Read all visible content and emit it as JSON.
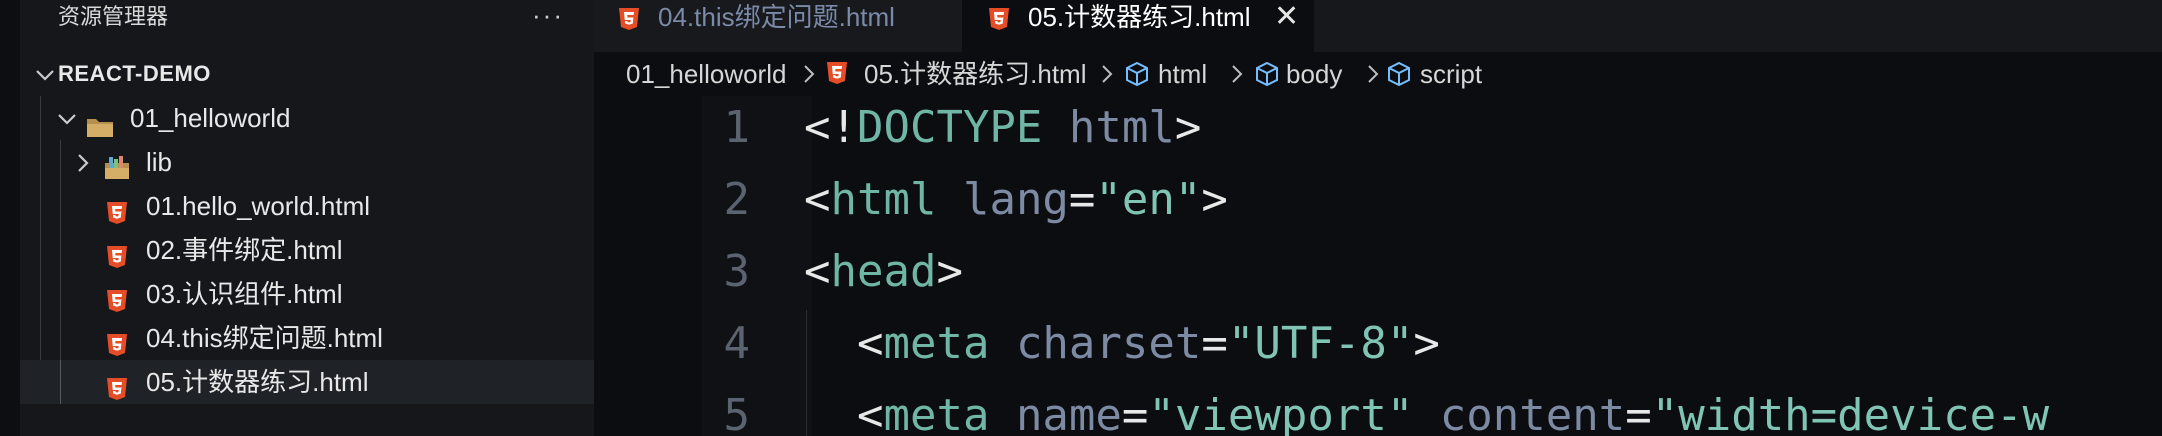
{
  "explorer": {
    "title": "资源管理器",
    "more": "···",
    "project": "REACT-DEMO",
    "folder": "01_helloworld",
    "subfolder": "lib",
    "files": [
      "01.hello_world.html",
      "02.事件绑定.html",
      "03.认识组件.html",
      "04.this绑定问题.html",
      "05.计数器练习.html"
    ]
  },
  "tabs": [
    {
      "label": "04.this绑定问题.html"
    },
    {
      "label": "05.计数器练习.html",
      "close": "✕"
    }
  ],
  "breadcrumb": {
    "folder": "01_helloworld",
    "file": "05.计数器练习.html",
    "sym1": "html",
    "sym2": "body",
    "sym3": "script"
  },
  "editor": {
    "line_numbers": [
      "1",
      "2",
      "3",
      "4",
      "5"
    ],
    "lines": [
      {
        "t1": "<!",
        "t2": "DOCTYPE",
        "t3": " html",
        "t4": ">"
      },
      {
        "t1": "<",
        "t2": "html",
        "t3": " lang",
        "t4": "=",
        "t5": "\"en\"",
        "t6": ">"
      },
      {
        "t1": "<",
        "t2": "head",
        "t3": ">"
      },
      {
        "t0": "  ",
        "t1": "<",
        "t2": "meta",
        "t3": " charset",
        "t4": "=",
        "t5": "\"UTF-8\"",
        "t6": ">"
      },
      {
        "t0": "  ",
        "t1": "<",
        "t2": "meta",
        "t3": " name",
        "t4": "=",
        "t5": "\"viewport\"",
        "t6": " content",
        "t7": "=",
        "t8": "\"width=device-w"
      }
    ]
  },
  "colors": {
    "html_icon": "#e44d26",
    "folder_icon": "#c9a25a",
    "symbol_icon": "#75beff"
  }
}
